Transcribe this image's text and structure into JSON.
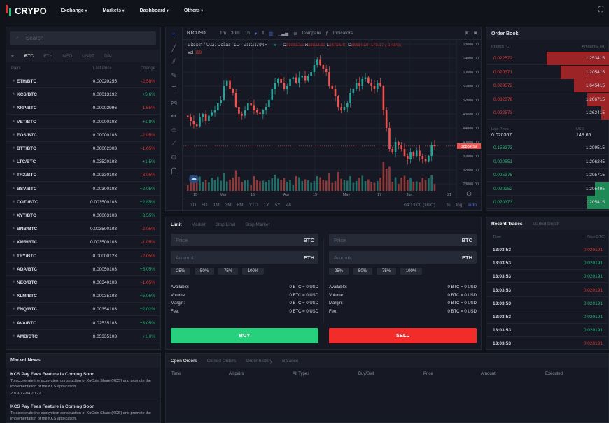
{
  "nav": {
    "brand": "CRYPO",
    "menus": [
      "Exchange",
      "Markets",
      "Dashboard",
      "Others"
    ]
  },
  "markets": {
    "search_placeholder": "Search",
    "tabs": [
      "BTC",
      "ETH",
      "NEO",
      "USDT",
      "DAI"
    ],
    "headers": [
      "Pairs",
      "Last Price",
      "Change"
    ],
    "rows": [
      [
        "ETH/BTC",
        "0.00020255",
        "-2.58%"
      ],
      [
        "KCS/BTC",
        "0.00013192",
        "+5.6%"
      ],
      [
        "XRP/BTC",
        "0.00002996",
        "-1.55%"
      ],
      [
        "VET/BTC",
        "0.00000103",
        "+1.8%"
      ],
      [
        "EOS/BTC",
        "0.00000103",
        "-2.05%"
      ],
      [
        "BTT/BTC",
        "0.00002303",
        "-1.05%"
      ],
      [
        "LTC/BTC",
        "0.03520103",
        "+1.5%"
      ],
      [
        "TRX/BTC",
        "0.00330103",
        "-3.05%"
      ],
      [
        "BSV/BTC",
        "0.00300103",
        "+2.05%"
      ],
      [
        "COTI/BTC",
        "0.003500103",
        "+2.85%"
      ],
      [
        "XYT/BTC",
        "0.00003103",
        "+3.55%"
      ],
      [
        "BNB/BTC",
        "0.003500103",
        "-2.05%"
      ],
      [
        "XMR/BTC",
        "0.003500103",
        "-1.05%"
      ],
      [
        "TRY/BTC",
        "0.00000123",
        "-2.05%"
      ],
      [
        "ADA/BTC",
        "0.00050103",
        "+5.05%"
      ],
      [
        "NEO/BTC",
        "0.00340103",
        "-1.05%"
      ],
      [
        "XLM/BTC",
        "0.00035103",
        "+5.05%"
      ],
      [
        "ENQ/BTC",
        "0.00354103",
        "+2.02%"
      ],
      [
        "AVA/BTC",
        "0.02535103",
        "+3.05%"
      ],
      [
        "AMB/BTC",
        "0.05335103",
        "+1.0%"
      ]
    ]
  },
  "chart": {
    "symbol": "BTCUSD",
    "intervals": [
      "1m",
      "30m",
      "1h"
    ],
    "compare": "Compare",
    "indicators": "Indicators",
    "title": "Bitcoin / U.S. Dollar",
    "tf": "1D",
    "exchange": "BITSTAMP",
    "ohlc": {
      "o_label": "O",
      "o": "39035.52",
      "h_label": "H",
      "h": "39838.92",
      "l_label": "L",
      "l": "38758.40",
      "c_label": "C",
      "c": "38834.59",
      "chg": "-179.17 (-0.46%)"
    },
    "vol_label": "Vol",
    "vol": "699",
    "last_price_tag": "38834.59",
    "y_ticks": [
      "68000.00",
      "64000.00",
      "60000.00",
      "56000.00",
      "52000.00",
      "48000.00",
      "44000.00",
      "40000.00",
      "36000.00",
      "32000.00",
      "28000.00"
    ],
    "x_ticks": [
      "15",
      "Mar",
      "15",
      "Apr",
      "15",
      "May",
      "17",
      "Jun",
      "21"
    ],
    "ranges": [
      "1D",
      "5D",
      "1M",
      "3M",
      "6M",
      "YTD",
      "1Y",
      "5Y",
      "All"
    ],
    "time": "04:13:00 (UTC)",
    "pct": "%",
    "log": "log",
    "auto": "auto",
    "closes_k": [
      47,
      46,
      45,
      44.5,
      47,
      48,
      46,
      47.5,
      48.5,
      49,
      51,
      52,
      56,
      57.5,
      55,
      54,
      50,
      48,
      47.5,
      49,
      51,
      50.5,
      49,
      48.5,
      48,
      49,
      50,
      52,
      55,
      57,
      58,
      57,
      55,
      56,
      58,
      58.5,
      57,
      58.5,
      59,
      57.5,
      59,
      60,
      62,
      63.5,
      62,
      61,
      60,
      56,
      55,
      53,
      50,
      49,
      50,
      51,
      54,
      55,
      57,
      56,
      58,
      58.5,
      57,
      56,
      55,
      57,
      56,
      49,
      44,
      38,
      37,
      40,
      39,
      38,
      36,
      35,
      37,
      36,
      37.5,
      36,
      35,
      34.5,
      36,
      39,
      38.8
    ]
  },
  "form": {
    "tabs": [
      "Limit",
      "Market",
      "Stop Limit",
      "Stop Market"
    ],
    "price_placeholder": "Price",
    "price_unit": "BTC",
    "amount_placeholder": "Amount",
    "amount_unit": "ETH",
    "pcts": [
      "25%",
      "50%",
      "75%",
      "100%"
    ],
    "info": [
      [
        "Available:",
        "0 BTC = 0 USD"
      ],
      [
        "Volume:",
        "0 BTC = 0 USD"
      ],
      [
        "Margin:",
        "0 BTC = 0 USD"
      ],
      [
        "Fee:",
        "0 BTC = 0 USD"
      ]
    ],
    "buy": "BUY",
    "sell": "SELL"
  },
  "orderbook": {
    "title": "Order Book",
    "headers": [
      "Price(BTC)",
      "Amount(ETH)"
    ],
    "asks": [
      [
        "0.022572",
        "1.253415",
        0.51
      ],
      [
        "0.020371",
        "1.205415",
        0.4
      ],
      [
        "0.023572",
        "1.645415",
        0.29
      ],
      [
        "0.032378",
        "1.206715",
        0.18
      ],
      [
        "0.022573",
        "1.262415",
        0.07
      ]
    ],
    "last_label": "Last Price",
    "last": "0.020367",
    "usd_label": "USD",
    "usd": "148.65",
    "bids": [
      [
        "0.158373",
        "1.209515",
        0
      ],
      [
        "0.020851",
        "1.206245",
        0
      ],
      [
        "0.025375",
        "1.205715",
        0
      ],
      [
        "0.020252",
        "1.205495",
        0.12
      ],
      [
        "0.020373",
        "1.205415",
        0.18
      ]
    ]
  },
  "trades": {
    "tabs": [
      "Recent Trades",
      "Market Depth"
    ],
    "headers": [
      "Time",
      "Price(BTC)"
    ],
    "rows": [
      [
        "13:03:53",
        "0.020191",
        "sell"
      ],
      [
        "13:03:53",
        "0.020191",
        "buy"
      ],
      [
        "13:03:53",
        "0.020191",
        "buy"
      ],
      [
        "13:03:53",
        "0.020191",
        "sell"
      ],
      [
        "13:03:53",
        "0.020191",
        "buy"
      ],
      [
        "13:03:53",
        "0.020191",
        "buy"
      ],
      [
        "13:03:53",
        "0.020191",
        "buy"
      ],
      [
        "13:03:53",
        "0.020191",
        "sell"
      ]
    ]
  },
  "news": {
    "title": "Market News",
    "items": [
      {
        "title": "KCS Pay Fees Feature is Coming Soon",
        "body": "To accelerate the ecosystem construction of KuCoin Share (KCS) and promote the implementation of the KCS application.",
        "date": "2019-12-04 20:22"
      },
      {
        "title": "KCS Pay Fees Feature is Coming Soon",
        "body": "To accelerate the ecosystem construction of KuCoin Share (KCS) and promote the implementation of the KCS application."
      }
    ]
  },
  "orders": {
    "tabs": [
      "Open Orders",
      "Closed Orders",
      "Order history",
      "Balance"
    ],
    "headers": [
      "Time",
      "All pairs",
      "All Types",
      "Buy/Sell",
      "Price",
      "Amount",
      "Executed"
    ]
  },
  "colors": {
    "green": "#22b573",
    "red": "#e0312f",
    "buy": "#26d07c",
    "sell": "#f22b2b"
  }
}
